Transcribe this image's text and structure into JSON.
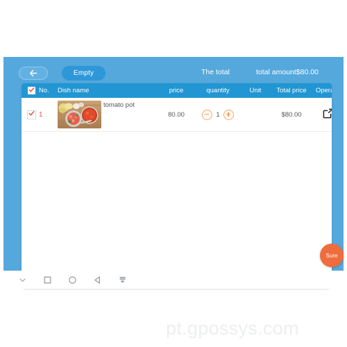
{
  "colors": {
    "panel_blue": "#55a8dc",
    "table_header_blue": "#2196d3",
    "empty_button_blue": "#2e97d8",
    "accent_orange": "#ef6c3c",
    "stepper_orange": "#f0a050",
    "row_number_red": "#e8584a"
  },
  "action_bar": {
    "back_icon": "arrow-left-icon",
    "empty_label": "Empty",
    "total_label": "The total",
    "total_amount": "total amount$80.00"
  },
  "table": {
    "columns": {
      "select_all_icon": "check-icon",
      "no": "No.",
      "dish_name": "Dish name",
      "price": "price",
      "quantity": "quantity",
      "unit": "Unit",
      "total_price": "Total price",
      "operate": "Operate"
    },
    "rows": [
      {
        "checked": true,
        "check_icon": "check-icon",
        "no": "1",
        "thumbnail_icon": "food-photo-tomato-pot",
        "dish_name": "tomato pot",
        "price": "80.00",
        "quantity": "1",
        "unit": "",
        "total_price": "$80.00",
        "operate_icon": "edit-square-icon",
        "minus_icon": "minus-circle-icon",
        "plus_icon": "plus-circle-icon"
      }
    ]
  },
  "fab": {
    "label": "Sure"
  },
  "nav_bar": {
    "items": [
      {
        "icon": "chevron-down-icon"
      },
      {
        "icon": "square-icon"
      },
      {
        "icon": "circle-icon"
      },
      {
        "icon": "back-triangle-icon"
      },
      {
        "icon": "keyboard-hide-icon"
      }
    ]
  },
  "watermark": {
    "text": "pt.gpossys.com"
  }
}
